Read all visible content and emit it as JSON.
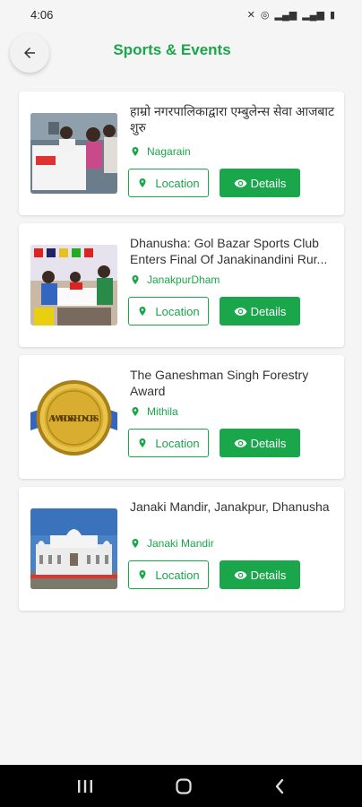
{
  "status_bar": {
    "time": "4:06"
  },
  "header": {
    "title": "Sports & Events"
  },
  "colors": {
    "accent": "#1aa64a",
    "background": "#f5f5f5"
  },
  "cards": [
    {
      "title": "हाम्रो नगरपालिकाद्वारा एम्बुलेन्स सेवा आजबाट शुरु",
      "location": "Nagarain",
      "location_label": "Location",
      "details_label": "Details",
      "image": "ambulance-handover-photo"
    },
    {
      "title": "Dhanusha: Gol Bazar Sports Club Enters Final Of Janakinandini Rur...",
      "location": "JanakpurDham",
      "location_label": "Location",
      "details_label": "Details",
      "image": "sports-team-photo"
    },
    {
      "title": "The Ganeshman Singh Forestry Award",
      "location": "Mithila",
      "location_label": "Location",
      "details_label": "Details",
      "image": "awards-honors-medal",
      "image_text": "AWARDS & HONORS"
    },
    {
      "title": "Janaki Mandir, Janakpur, Dhanusha",
      "location": "Janaki Mandir",
      "location_label": "Location",
      "details_label": "Details",
      "image": "janaki-mandir-temple-photo"
    }
  ]
}
